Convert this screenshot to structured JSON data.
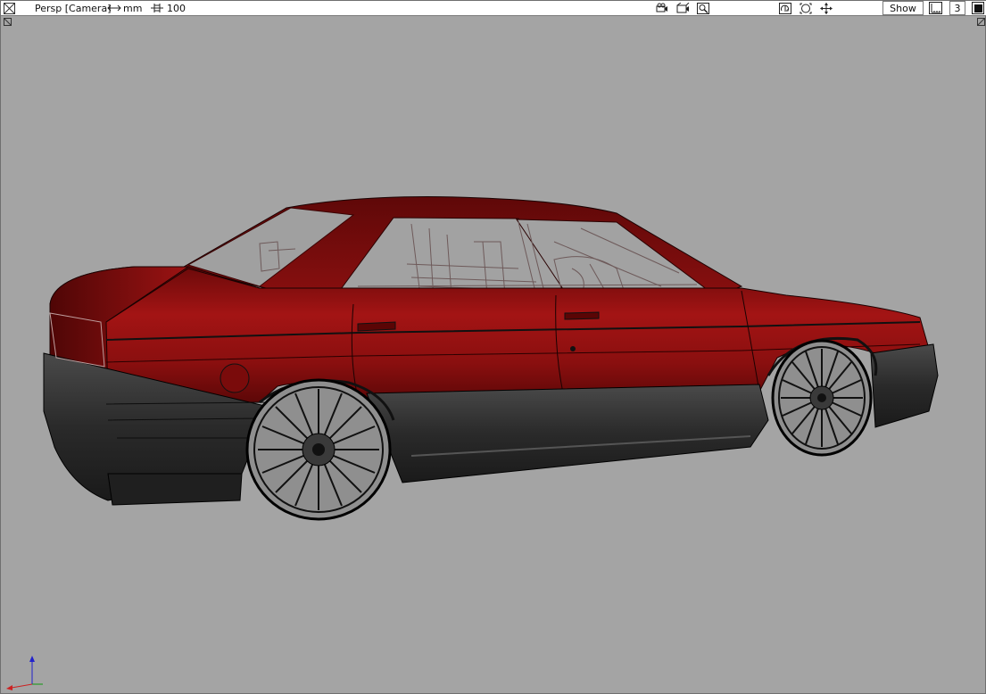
{
  "viewport": {
    "title": "Persp [Camera]",
    "units_label": "mm",
    "grid_label": "100",
    "show_button": "Show",
    "layer_number": "3"
  },
  "icons": {
    "close": "close-icon",
    "units": "double-arrow-icon",
    "grid": "grid-snap-icon",
    "camera_tumble": "camera-tumble-icon",
    "camera_track": "camera-track-icon",
    "zoom": "zoom-icon",
    "rotate_view": "rotate-view-icon",
    "frame_all": "frame-all-icon",
    "move_view": "move-view-icon",
    "ruler": "ruler-icon",
    "maximize": "maximize-icon",
    "axis": "axis-triad-icon"
  },
  "colors": {
    "background": "#a4a4a4",
    "body": "#8e0e0e",
    "trim": "#2b2b2b",
    "wire": "#6e5a5a"
  }
}
